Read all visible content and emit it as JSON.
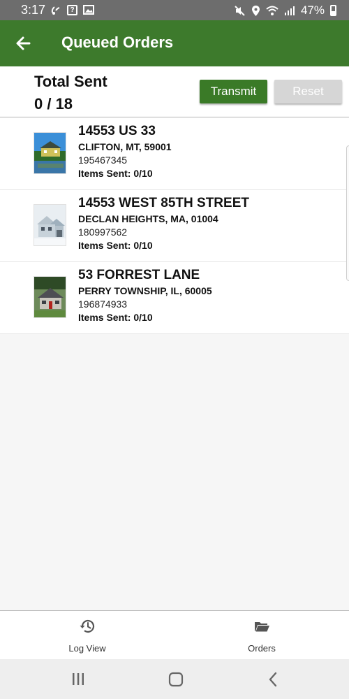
{
  "status_bar": {
    "time": "3:17",
    "battery": "47%",
    "icons": [
      "phone-wifi-icon",
      "help-icon",
      "image-icon",
      "mute-icon",
      "location-icon",
      "wifi-icon",
      "signal-icon",
      "battery-icon"
    ]
  },
  "app_bar": {
    "title": "Queued Orders",
    "back_icon": "arrow-left-icon",
    "background": "#3d7a2c"
  },
  "summary": {
    "label": "Total Sent",
    "value": "0 / 18",
    "transmit_label": "Transmit",
    "reset_label": "Reset",
    "transmit_color": "#3a7a27",
    "reset_color": "#d6d6d6"
  },
  "orders": [
    {
      "street": "14553 US 33",
      "city": "CLIFTON, MT, 59001",
      "number": "195467345",
      "items_sent": "Items Sent: 0/10"
    },
    {
      "street": "14553 WEST 85TH STREET",
      "city": "DECLAN HEIGHTS, MA, 01004",
      "number": "180997562",
      "items_sent": "Items Sent: 0/10"
    },
    {
      "street": "53 FORREST LANE",
      "city": "PERRY TOWNSHIP, IL, 60005",
      "number": "196874933",
      "items_sent": "Items Sent: 0/10"
    }
  ],
  "bottom_nav": {
    "log_view_label": "Log View",
    "orders_label": "Orders",
    "log_view_icon": "history-icon",
    "orders_icon": "folder-open-icon"
  },
  "system_nav": {
    "icons": [
      "recent-apps-icon",
      "home-icon",
      "back-icon"
    ]
  }
}
